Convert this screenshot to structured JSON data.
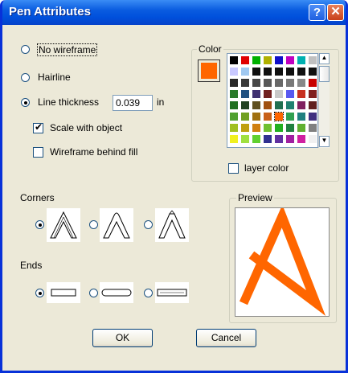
{
  "window": {
    "title": "Pen Attributes",
    "help_glyph": "?",
    "close_glyph": "✕"
  },
  "wireframe": {
    "options": [
      {
        "label": "No wireframe",
        "selected": false
      },
      {
        "label": "Hairline",
        "selected": false
      },
      {
        "label": "Line thickness",
        "selected": true
      }
    ],
    "thickness_value": "0.039",
    "thickness_unit": "in",
    "scale_with_object": {
      "label": "Scale with object",
      "checked": true
    },
    "wireframe_behind_fill": {
      "label": "Wireframe behind fill",
      "checked": false
    }
  },
  "color": {
    "group_label": "Color",
    "current_color": "#ff6600",
    "layer_color": {
      "label": "layer color",
      "checked": false
    },
    "palette": [
      [
        "#000000",
        "#e00000",
        "#00b000",
        "#b0b000",
        "#1010c8",
        "#c000c0",
        "#00b0b0",
        "#c0c0c0"
      ],
      [
        "#c8c8ff",
        "#a0c8f0",
        "#101010",
        "#101010",
        "#101010",
        "#101010",
        "#101010",
        "#101010"
      ],
      [
        "#282828",
        "#383838",
        "#484848",
        "#585858",
        "#686868",
        "#787878",
        "#888888",
        "#c80000"
      ],
      [
        "#2a7a2a",
        "#205080",
        "#403070",
        "#702020",
        "#c8c8c8",
        "#5858f0",
        "#c83020",
        "#802020"
      ],
      [
        "#207020",
        "#204020",
        "#605020",
        "#a05010",
        "#207050",
        "#208070",
        "#802060",
        "#602020"
      ],
      [
        "#50a030",
        "#70a020",
        "#a07010",
        "#c86018",
        "#ff6600",
        "#30a050",
        "#208080",
        "#403080"
      ],
      [
        "#a0c020",
        "#c0a010",
        "#d08010",
        "#70c030",
        "#20b020",
        "#208040",
        "#60b030",
        "#808080"
      ],
      [
        "#f0f020",
        "#a0e040",
        "#60d030",
        "#303090",
        "#6030a0",
        "#a020a0",
        "#d020a0",
        "#f0f0f0"
      ]
    ],
    "selected_cell": [
      5,
      4
    ]
  },
  "corners": {
    "label": "Corners",
    "options": [
      "miter-corner-icon",
      "round-corner-icon",
      "bevel-corner-icon"
    ],
    "selected": 0
  },
  "ends": {
    "label": "Ends",
    "options": [
      "flat-end-icon",
      "round-end-icon",
      "square-end-icon"
    ],
    "selected": 0
  },
  "preview": {
    "label": "Preview",
    "stroke_color": "#ff6600"
  },
  "buttons": {
    "ok": "OK",
    "cancel": "Cancel"
  }
}
